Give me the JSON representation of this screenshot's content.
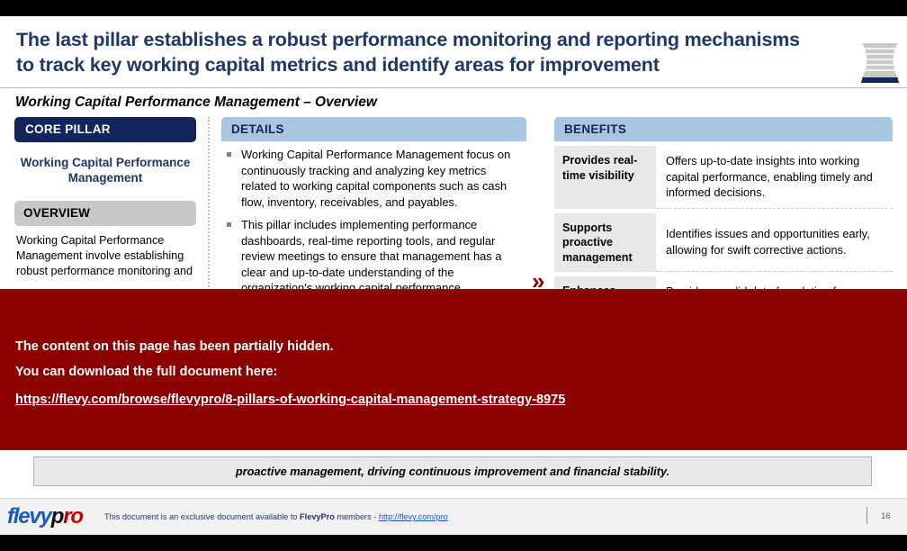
{
  "header": {
    "title_line1": "The last pillar establishes a robust performance monitoring and reporting mechanisms",
    "title_line2": "to track key working capital metrics and identify areas for improvement",
    "logo_icon": "pillar-column-icon"
  },
  "subtitle": "Working Capital Performance Management – Overview",
  "core_pillar": {
    "header": "CORE PILLAR",
    "pillar_name": "Working Capital Performance Management",
    "overview_header": "OVERVIEW",
    "overview_body": "Working Capital Performance Management involve establishing robust performance monitoring and"
  },
  "details": {
    "header": "DETAILS",
    "bullets": [
      "Working Capital Performance Management focus on continuously tracking and analyzing key metrics related to working capital components such as cash flow, inventory, receivables, and payables.",
      "This pillar includes implementing performance dashboards, real-time reporting tools, and regular review meetings to ensure that management has a clear and up-to-date understanding of the organization's working capital performance."
    ]
  },
  "arrow_icon": "double-chevron-right-icon",
  "benefits": {
    "header": "BENEFITS",
    "rows": [
      {
        "label": "Provides real-time visibility",
        "desc": "Offers up-to-date insights into working capital performance, enabling timely and informed decisions."
      },
      {
        "label": "Supports proactive management",
        "desc": "Identifies issues and opportunities early, allowing for swift corrective actions."
      },
      {
        "label": "Enhances decision-",
        "desc": "Provides a solid data foundation for strategic and operational decisions"
      }
    ]
  },
  "overlay": {
    "line1": "The content on this page has been partially hidden.",
    "line2": "You can download the full document here:",
    "link": "https://flevy.com/browse/flevypro/8-pillars-of-working-capital-management-strategy-8975",
    "background_color": "#8B0000"
  },
  "summary": "proactive management, driving continuous improvement and financial stability.",
  "footer": {
    "logo_part1": "flevy",
    "logo_part2": "p",
    "logo_part3": "ro",
    "text_before": "This document is an exclusive document available to ",
    "text_brand": "FlevyPro",
    "text_middle": " members - ",
    "link": "http://flevy.com/pro",
    "page_number": "16"
  },
  "colors": {
    "navy": "#13255B",
    "title_blue": "#1F3864",
    "header_blue": "#A8C6E0",
    "header_gray": "#C8C8C8",
    "overlay_red": "#8B0000",
    "label_gray": "#E8E8E8"
  }
}
